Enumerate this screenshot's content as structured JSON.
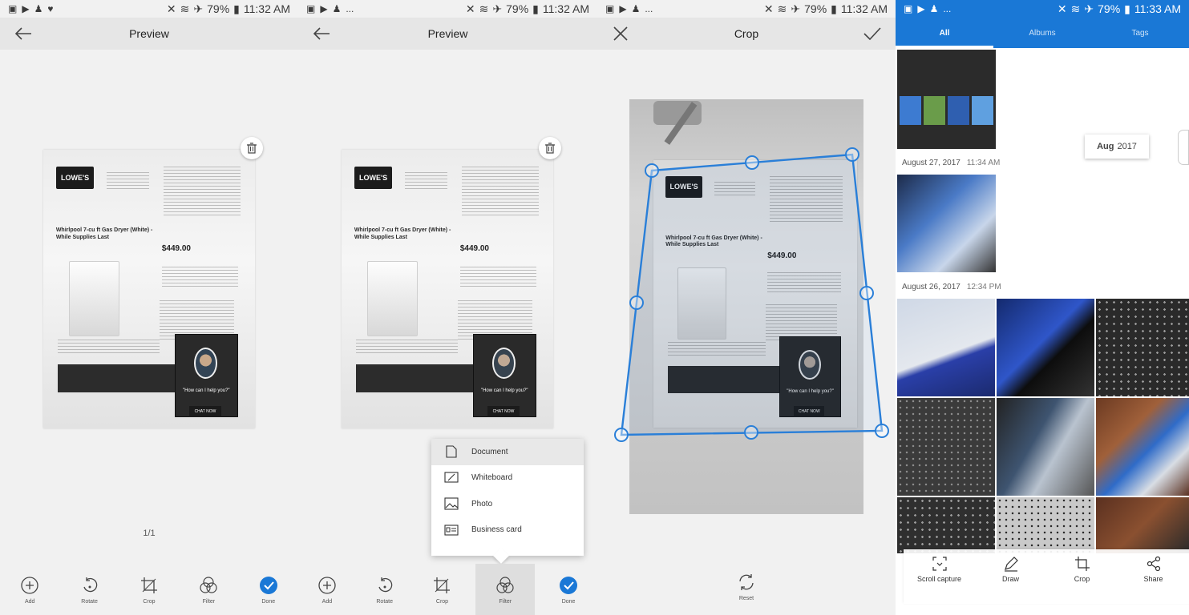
{
  "status": {
    "time1": "11:32 AM",
    "time2": "11:32 AM",
    "time3": "11:32 AM",
    "time4": "11:33 AM",
    "battery": "79%",
    "dots": "..."
  },
  "preview1": {
    "title": "Preview",
    "page_count": "1/1",
    "toolbar": [
      "Add",
      "Rotate",
      "Crop",
      "Filter",
      "Done"
    ]
  },
  "preview2": {
    "title": "Preview",
    "toolbar": [
      "Add",
      "Rotate",
      "Crop",
      "Filter",
      "Done"
    ],
    "filter_menu": [
      "Document",
      "Whiteboard",
      "Photo",
      "Business card"
    ],
    "selected_filter": "Document"
  },
  "crop": {
    "title": "Crop",
    "reset_label": "Reset"
  },
  "document": {
    "logo": "LOWE'S",
    "headline": "Whirlpool 7-cu ft Gas Dryer (White) - While Supplies Last",
    "price": "$449.00",
    "chat_question": "\"How can I help you?\"",
    "chat_button": "CHAT NOW",
    "delivered": "Need It Delivered? Lowe's"
  },
  "gallery": {
    "tabs": [
      "All",
      "Albums",
      "Tags"
    ],
    "month_chip_month": "Aug",
    "month_chip_year": "2017",
    "date1": "August 27, 2017",
    "time_1": "11:34 AM",
    "date2": "August 26, 2017",
    "time_2": "12:34 PM",
    "share_actions": [
      "Scroll capture",
      "Draw",
      "Crop",
      "Share"
    ]
  },
  "colors": {
    "accent": "#1a78d6",
    "done_blue": "#1a78d6",
    "crop_line": "#2a7fd8"
  }
}
